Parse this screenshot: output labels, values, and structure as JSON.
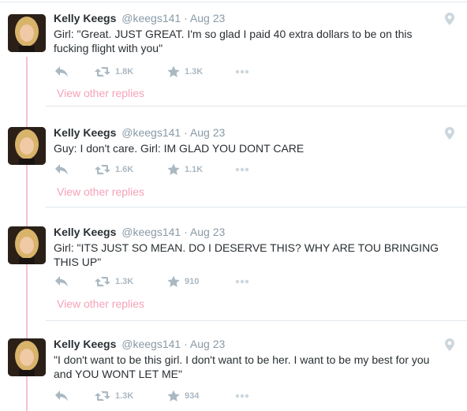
{
  "colors": {
    "accent_pink": "#f6a2b8",
    "thread_line": "#f5c2cf",
    "muted": "#8899a6",
    "action_gray": "#aab8c2",
    "text": "#292f33"
  },
  "icons": {
    "reply": "reply-icon",
    "retweet": "retweet-icon",
    "like": "star-icon",
    "more": "more-icon",
    "location": "location-pin-icon"
  },
  "tweets": [
    {
      "name": "Kelly Keegs",
      "handle": "@keegs141",
      "separator": "·",
      "date": "Aug 23",
      "text": "Girl: \"Great. JUST GREAT. I'm so glad I paid 40 extra dollars to be on this fucking flight with you\"",
      "retweets": "1.8K",
      "likes": "1.3K",
      "view_replies": "View other replies"
    },
    {
      "name": "Kelly Keegs",
      "handle": "@keegs141",
      "separator": "·",
      "date": "Aug 23",
      "text": "Guy: I don't care. Girl: IM GLAD YOU DONT CARE",
      "retweets": "1.6K",
      "likes": "1.1K",
      "view_replies": "View other replies"
    },
    {
      "name": "Kelly Keegs",
      "handle": "@keegs141",
      "separator": "·",
      "date": "Aug 23",
      "text": "Girl: \"ITS JUST SO MEAN. DO I DESERVE THIS? WHY ARE TOU BRINGING THIS UP\"",
      "retweets": "1.3K",
      "likes": "910",
      "view_replies": "View other replies"
    },
    {
      "name": "Kelly Keegs",
      "handle": "@keegs141",
      "separator": "·",
      "date": "Aug 23",
      "text": "\"I don't want to be this girl. I don't want to be her. I want to be my best for you and YOU WONT LET ME\"",
      "retweets": "1.3K",
      "likes": "934"
    }
  ]
}
